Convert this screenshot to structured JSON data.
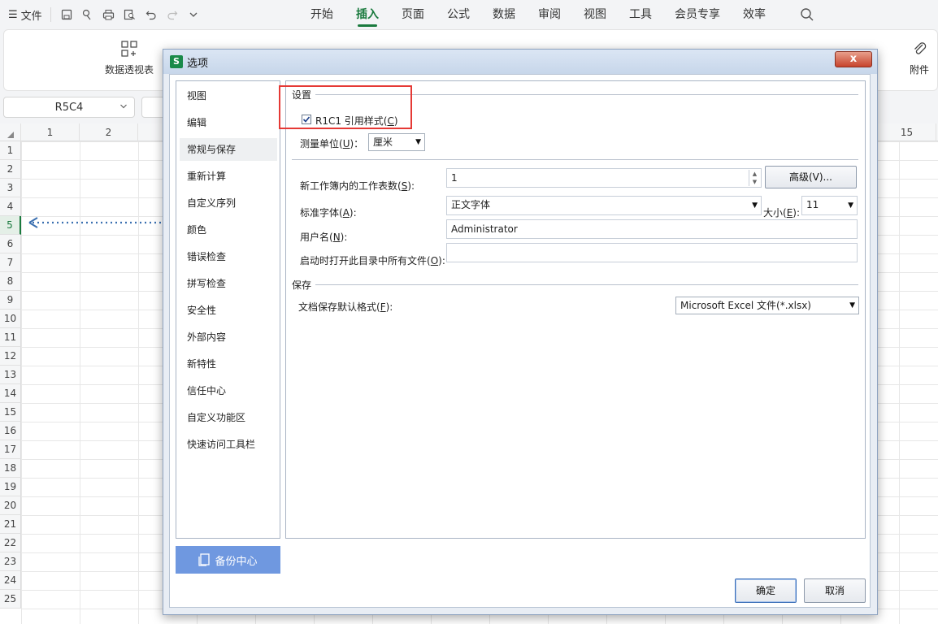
{
  "topbar": {
    "file_label": "文件",
    "tabs": [
      "开始",
      "插入",
      "页面",
      "公式",
      "数据",
      "审阅",
      "视图",
      "工具",
      "会员专享",
      "效率"
    ],
    "active_tab": "插入"
  },
  "ribbon": {
    "pivot_label": "数据透视表",
    "attach_label": "附件"
  },
  "namebox": {
    "value": "R5C4"
  },
  "grid": {
    "columns": [
      "1",
      "2",
      "15"
    ],
    "rows": [
      "1",
      "2",
      "3",
      "4",
      "5",
      "6",
      "7",
      "8",
      "9",
      "10",
      "11",
      "12",
      "13",
      "14",
      "15",
      "16",
      "17",
      "18",
      "19",
      "20",
      "21",
      "22",
      "23",
      "24",
      "25"
    ],
    "selected_row": "5"
  },
  "dialog": {
    "title": "选项",
    "close_label": "x",
    "nav_items": [
      "视图",
      "编辑",
      "常规与保存",
      "重新计算",
      "自定义序列",
      "颜色",
      "错误检查",
      "拼写检查",
      "安全性",
      "外部内容",
      "新特性",
      "信任中心",
      "自定义功能区",
      "快速访问工具栏"
    ],
    "nav_active": "常规与保存",
    "backup_label": "备份中心",
    "settings_section": "设置",
    "r1c1_label_pre": "R1C1 引用样式(",
    "r1c1_label_key": "C",
    "r1c1_label_post": ")",
    "r1c1_checked": true,
    "unit_label_pre": "测量单位(",
    "unit_label_key": "U",
    "unit_label_post": ")：",
    "unit_value": "厘米",
    "sheets_label_pre": "新工作簿内的工作表数(",
    "sheets_label_key": "S",
    "sheets_label_post": "):",
    "sheets_value": "1",
    "advanced_label": "高级(V)...",
    "font_label_pre": "标准字体(",
    "font_label_key": "A",
    "font_label_post": "):",
    "font_value": "正文字体",
    "size_label_pre": "大小(",
    "size_label_key": "E",
    "size_label_post": "):",
    "size_value": "11",
    "username_label_pre": "用户名(",
    "username_label_key": "N",
    "username_label_post": "):",
    "username_value": "Administrator",
    "startup_label_pre": "启动时打开此目录中所有文件(",
    "startup_label_key": "O",
    "startup_label_post": "):",
    "startup_value": "",
    "save_section": "保存",
    "format_label_pre": "文档保存默认格式(",
    "format_label_key": "F",
    "format_label_post": "):",
    "format_value": "Microsoft Excel 文件(*.xlsx)",
    "ok_label": "确定",
    "cancel_label": "取消"
  },
  "colors": {
    "accent": "#1a7a3e",
    "highlight": "#e53935",
    "backup": "#6f98e0"
  }
}
